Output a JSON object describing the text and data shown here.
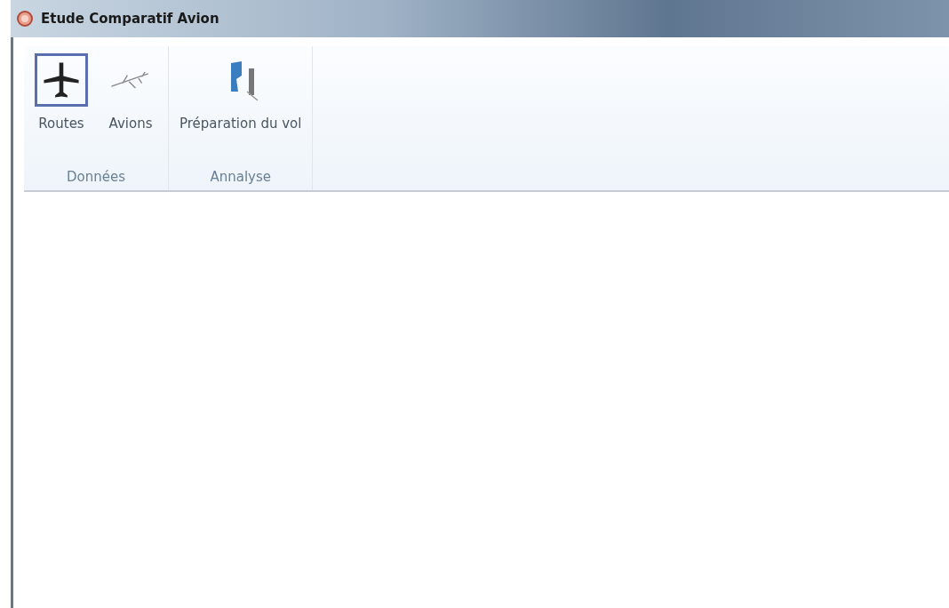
{
  "window": {
    "title": "Etude Comparatif Avion"
  },
  "ribbon": {
    "groups": [
      {
        "label": "Données",
        "buttons": [
          {
            "label": "Routes",
            "kind": "plane",
            "selected": true
          },
          {
            "label": "Avions",
            "kind": "sketch",
            "selected": false
          }
        ]
      },
      {
        "label": "Annalyse",
        "buttons": [
          {
            "label": "Préparation du vol",
            "kind": "report",
            "selected": false
          }
        ]
      }
    ]
  }
}
